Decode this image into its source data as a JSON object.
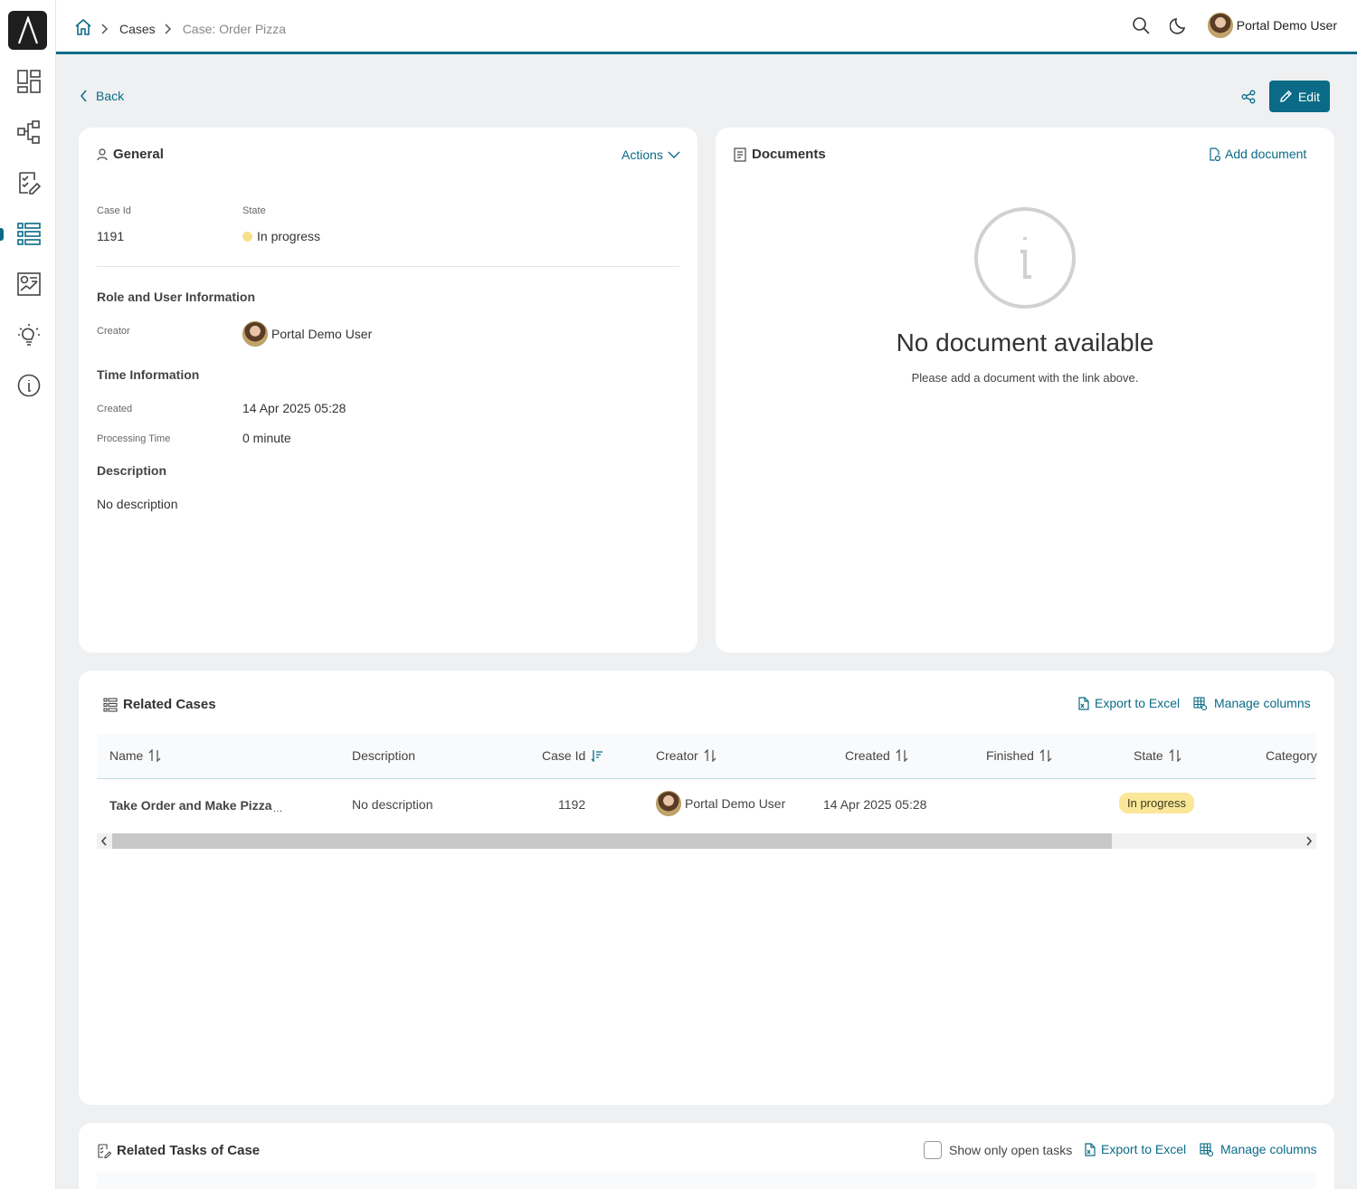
{
  "topbar": {
    "breadcrumb": {
      "cases": "Cases",
      "current": "Case: Order Pizza"
    },
    "user_name": "Portal Demo User"
  },
  "page": {
    "back_label": "Back",
    "edit_label": "Edit"
  },
  "general": {
    "title": "General",
    "actions_label": "Actions",
    "case_id_label": "Case Id",
    "case_id": "1191",
    "state_label": "State",
    "state": "In progress",
    "role_section": "Role and User Information",
    "creator_label": "Creator",
    "creator": "Portal Demo User",
    "time_section": "Time Information",
    "created_label": "Created",
    "created": "14 Apr 2025 05:28",
    "processing_label": "Processing Time",
    "processing": "0 minute",
    "description_section": "Description",
    "description": "No description"
  },
  "documents": {
    "title": "Documents",
    "add_label": "Add document",
    "empty_title": "No document available",
    "empty_hint": "Please add a document with the link above."
  },
  "related_cases": {
    "title": "Related Cases",
    "export_label": "Export to Excel",
    "manage_label": "Manage columns",
    "columns": [
      "Name",
      "Description",
      "Case Id",
      "Creator",
      "Created",
      "Finished",
      "State",
      "Category"
    ],
    "rows": [
      {
        "name": "Take Order and Make Pizza",
        "description": "No description",
        "case_id": "1192",
        "creator": "Portal Demo User",
        "created": "14 Apr 2025 05:28",
        "finished": "",
        "state": "In progress",
        "category": ""
      }
    ]
  },
  "related_tasks": {
    "title": "Related Tasks of Case",
    "open_only_label": "Show only open tasks",
    "export_label": "Export to Excel",
    "manage_label": "Manage columns"
  },
  "colors": {
    "accent": "#0b6b86",
    "in_progress_badge": "#fbe79a",
    "page_bg": "#eef0f2"
  }
}
